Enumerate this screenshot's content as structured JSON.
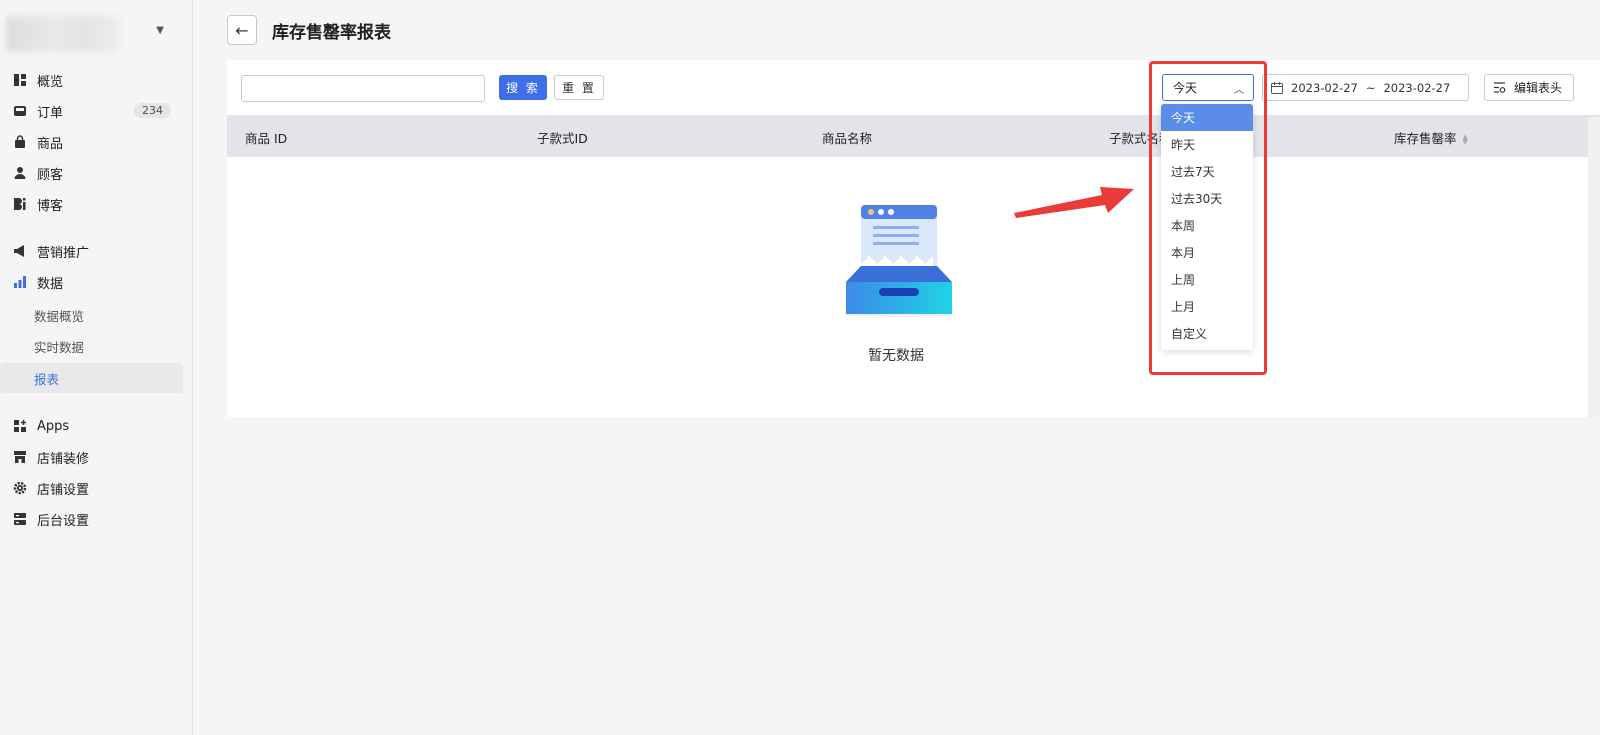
{
  "page": {
    "title": "库存售罄率报表"
  },
  "sidebar": {
    "items": [
      {
        "label": "概览",
        "icon": "overview-icon"
      },
      {
        "label": "订单",
        "icon": "inbox-icon",
        "badge": "234"
      },
      {
        "label": "商品",
        "icon": "bag-icon"
      },
      {
        "label": "顾客",
        "icon": "user-icon"
      },
      {
        "label": "博客",
        "icon": "blog-icon"
      },
      {
        "label": "营销推广",
        "icon": "megaphone-icon"
      },
      {
        "label": "数据",
        "icon": "bar-chart-icon"
      },
      {
        "label": "Apps",
        "icon": "apps-icon"
      },
      {
        "label": "店铺装修",
        "icon": "store-icon"
      },
      {
        "label": "店铺设置",
        "icon": "gear-icon"
      },
      {
        "label": "后台设置",
        "icon": "server-icon"
      }
    ],
    "sub_items": [
      {
        "label": "数据概览"
      },
      {
        "label": "实时数据"
      },
      {
        "label": "报表",
        "active": true
      }
    ]
  },
  "toolbar": {
    "search_value": "",
    "search_label": "搜 索",
    "reset_label": "重 置",
    "range_selected": "今天",
    "date_start": "2023-02-27",
    "date_sep": "~",
    "date_end": "2023-02-27",
    "edit_columns_label": "编辑表头"
  },
  "table": {
    "columns": [
      "商品 ID",
      "子款式ID",
      "商品名称",
      "子款式名称",
      "库存售罄率"
    ],
    "empty_text": "暂无数据"
  },
  "dropdown": {
    "options": [
      "今天",
      "昨天",
      "过去7天",
      "过去30天",
      "本周",
      "本月",
      "上周",
      "上月",
      "自定义"
    ],
    "selected_index": 0
  },
  "colors": {
    "primary": "#3e6fe8",
    "annotation": "#ea3a3a",
    "active_option": "#5a8ce8"
  }
}
